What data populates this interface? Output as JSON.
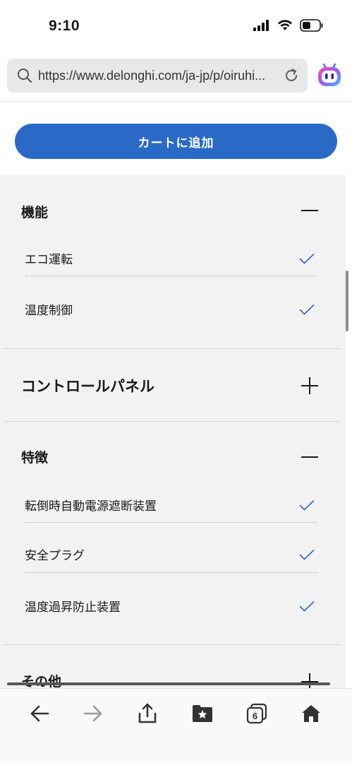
{
  "status_bar": {
    "time": "9:10"
  },
  "browser": {
    "url": "https://www.delonghi.com/ja-jp/p/oiruhi...",
    "tab_count": "6"
  },
  "cart": {
    "button_label": "カートに追加"
  },
  "sections": {
    "function": {
      "title": "機能",
      "expanded": true,
      "items": [
        "エコ運転",
        "温度制御"
      ]
    },
    "control_panel": {
      "title": "コントロールパネル",
      "expanded": false
    },
    "features": {
      "title": "特徴",
      "expanded": true,
      "items": [
        "転倒時自動電源遮断装置",
        "安全プラグ",
        "温度過昇防止装置"
      ]
    },
    "other": {
      "title": "その他",
      "expanded": false
    }
  },
  "colors": {
    "accent": "#2a6ac6",
    "check": "#2a6ac6",
    "panel_bg": "#f2f2f2"
  }
}
